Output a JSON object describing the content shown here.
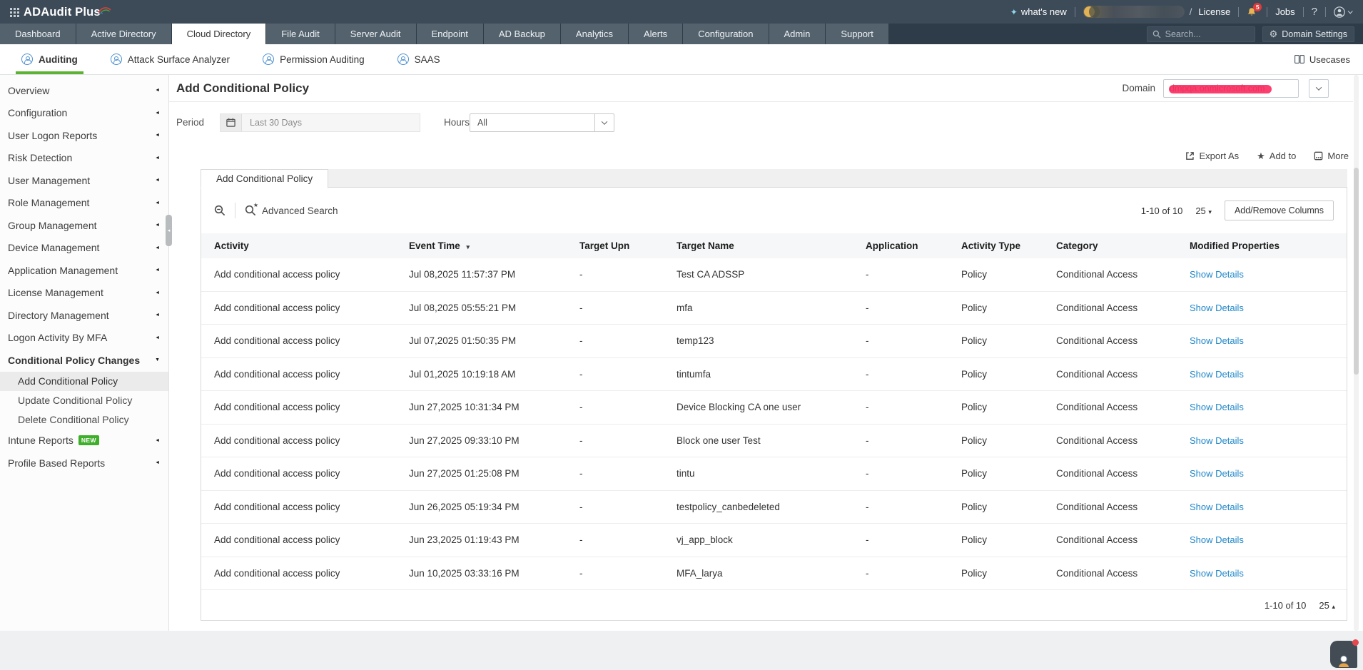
{
  "brand": {
    "name": "ADAudit Plus"
  },
  "topbar": {
    "whats_new": "what's new",
    "slash": "/",
    "license": "License",
    "notification_count": "5",
    "jobs": "Jobs",
    "help": "?"
  },
  "nav": {
    "tabs": [
      {
        "label": "Dashboard"
      },
      {
        "label": "Active Directory"
      },
      {
        "label": "Cloud Directory",
        "cls": "active"
      },
      {
        "label": "File Audit"
      },
      {
        "label": "Server Audit"
      },
      {
        "label": "Endpoint"
      },
      {
        "label": "AD Backup"
      },
      {
        "label": "Analytics"
      },
      {
        "label": "Alerts"
      },
      {
        "label": "Configuration"
      },
      {
        "label": "Admin"
      },
      {
        "label": "Support"
      }
    ],
    "search_placeholder": "Search...",
    "domain_settings": "Domain Settings"
  },
  "subnav": {
    "items": [
      {
        "label": "Auditing",
        "cls": "active",
        "icon": "auditing-icon"
      },
      {
        "label": "Attack Surface Analyzer",
        "icon": "attack-surface-analyzer-icon"
      },
      {
        "label": "Permission Auditing",
        "icon": "permission-auditing-icon"
      },
      {
        "label": "SAAS",
        "icon": "saas-icon"
      }
    ],
    "usecases": "Usecases"
  },
  "sidebar": {
    "items": [
      {
        "label": "Overview",
        "chev": "chevron-left-icon"
      },
      {
        "label": "Configuration",
        "chev": "chevron-left-icon"
      },
      {
        "label": "User Logon Reports",
        "chev": "chevron-left-icon"
      },
      {
        "label": "Risk Detection",
        "chev": "chevron-left-icon"
      },
      {
        "label": "User Management",
        "chev": "chevron-left-icon"
      },
      {
        "label": "Role Management",
        "chev": "chevron-left-icon"
      },
      {
        "label": "Group Management",
        "chev": "chevron-left-icon"
      },
      {
        "label": "Device Management",
        "chev": "chevron-left-icon"
      },
      {
        "label": "Application Management",
        "chev": "chevron-left-icon"
      },
      {
        "label": "License Management",
        "chev": "chevron-left-icon"
      },
      {
        "label": "Directory Management",
        "chev": "chevron-left-icon"
      },
      {
        "label": "Logon Activity By MFA",
        "chev": "chevron-left-icon"
      },
      {
        "label": "Conditional Policy Changes",
        "cls": "expanded",
        "chev": "chevron-down-icon"
      },
      {
        "label": "Add Conditional Policy",
        "cls": "child selected"
      },
      {
        "label": "Update Conditional Policy",
        "cls": "child"
      },
      {
        "label": "Delete Conditional Policy",
        "cls": "child"
      },
      {
        "label": "Intune Reports",
        "badge": "NEW",
        "chev": "chevron-left-icon"
      },
      {
        "label": "Profile Based Reports",
        "chev": "chevron-left-icon"
      }
    ]
  },
  "main": {
    "title": "Add Conditional Policy",
    "domain_label": "Domain",
    "domain_value": "dmpqa.onmicrosoft.com",
    "period_label": "Period",
    "period_value": "Last 30 Days",
    "hours_label": "Hours",
    "hours_value": "All",
    "actions": {
      "export": "Export As",
      "add_to": "Add to",
      "more": "More"
    },
    "report_tab": "Add Conditional Policy",
    "advanced_search": "Advanced Search",
    "pagination_top": {
      "range": "1-10 of 10",
      "page_size": "25"
    },
    "add_remove_columns": "Add/Remove Columns",
    "pagination_bottom": {
      "range": "1-10 of 10",
      "page_size": "25"
    }
  },
  "table": {
    "columns": [
      "Activity",
      "Event Time",
      "Target Upn",
      "Target Name",
      "Application",
      "Activity Type",
      "Category",
      "Modified Properties"
    ],
    "rows": [
      {
        "activity": "Add conditional access policy",
        "time": "Jul 08,2025 11:57:37 PM",
        "upn": "-",
        "target": "Test CA ADSSP",
        "app": "-",
        "type": "Policy",
        "category": "Conditional Access",
        "link": "Show Details"
      },
      {
        "activity": "Add conditional access policy",
        "time": "Jul 08,2025 05:55:21 PM",
        "upn": "-",
        "target": "mfa",
        "app": "-",
        "type": "Policy",
        "category": "Conditional Access",
        "link": "Show Details"
      },
      {
        "activity": "Add conditional access policy",
        "time": "Jul 07,2025 01:50:35 PM",
        "upn": "-",
        "target": "temp123",
        "app": "-",
        "type": "Policy",
        "category": "Conditional Access",
        "link": "Show Details"
      },
      {
        "activity": "Add conditional access policy",
        "time": "Jul 01,2025 10:19:18 AM",
        "upn": "-",
        "target": "tintumfa",
        "app": "-",
        "type": "Policy",
        "category": "Conditional Access",
        "link": "Show Details"
      },
      {
        "activity": "Add conditional access policy",
        "time": "Jun 27,2025 10:31:34 PM",
        "upn": "-",
        "target": "Device Blocking CA one user",
        "app": "-",
        "type": "Policy",
        "category": "Conditional Access",
        "link": "Show Details"
      },
      {
        "activity": "Add conditional access policy",
        "time": "Jun 27,2025 09:33:10 PM",
        "upn": "-",
        "target": "Block one user Test",
        "app": "-",
        "type": "Policy",
        "category": "Conditional Access",
        "link": "Show Details"
      },
      {
        "activity": "Add conditional access policy",
        "time": "Jun 27,2025 01:25:08 PM",
        "upn": "-",
        "target": "tintu",
        "app": "-",
        "type": "Policy",
        "category": "Conditional Access",
        "link": "Show Details"
      },
      {
        "activity": "Add conditional access policy",
        "time": "Jun 26,2025 05:19:34 PM",
        "upn": "-",
        "target": "testpolicy_canbedeleted",
        "app": "-",
        "type": "Policy",
        "category": "Conditional Access",
        "link": "Show Details"
      },
      {
        "activity": "Add conditional access policy",
        "time": "Jun 23,2025 01:19:43 PM",
        "upn": "-",
        "target": "vj_app_block",
        "app": "-",
        "type": "Policy",
        "category": "Conditional Access",
        "link": "Show Details"
      },
      {
        "activity": "Add conditional access policy",
        "time": "Jun 10,2025 03:33:16 PM",
        "upn": "-",
        "target": "MFA_larya",
        "app": "-",
        "type": "Policy",
        "category": "Conditional Access",
        "link": "Show Details"
      }
    ]
  },
  "colors": {
    "accent_green": "#5cb233",
    "link_blue": "#1f87c9",
    "redaction_pink": "#fb2a5e",
    "header_dark": "#3d4b59"
  }
}
